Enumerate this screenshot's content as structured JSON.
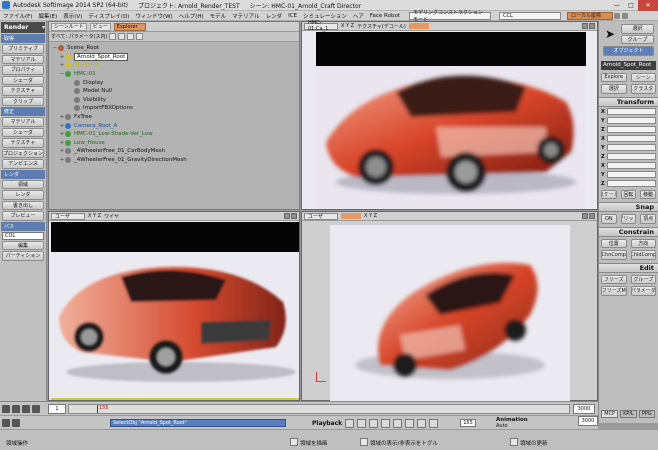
{
  "titlebar": {
    "app": "Autodesk Softimage 2014 SP2 (64-bit)",
    "project": "プロジェクト: Arnold_Render_TEST",
    "scene": "シーン: HMC-01_Arnold_Craft Director"
  },
  "menubar": {
    "items": [
      "ファイル(F)",
      "編集(E)",
      "表示(V)",
      "ディスプレイ(D)",
      "ウィンドウ(W)",
      "ヘルプ(H)",
      "モデル",
      "マテリアル",
      "レンダ",
      "ICE",
      "シミュレーション",
      "ヘア",
      "Face Robot"
    ],
    "layout": "モデリングコンストラクションモード",
    "combo": "CCL",
    "layer": "ローカル座標"
  },
  "leftbar": {
    "mode": "Render",
    "sections": [
      {
        "title": "取得",
        "items": [
          "プリミティブ",
          "マテリアル",
          "プロパティ",
          "シェーダ",
          "テクスチャ",
          "クリップ"
        ]
      },
      {
        "title": "修正",
        "items": [
          "マテリアル",
          "シェーダ",
          "テクスチャ",
          "プロジェクション",
          "アンビエンス"
        ]
      },
      {
        "title": "レンダ",
        "items": [
          "領域",
          "レンダ",
          "書き出し",
          "プレビュー"
        ]
      },
      {
        "title": "パス",
        "items": []
      }
    ],
    "pass_field": "COL",
    "bottom_items": [
      "編集",
      "パーティション"
    ]
  },
  "explorer": {
    "scope": "シーンルート",
    "view": "ビュー",
    "filter": "すべて: パラメータ(ス内)",
    "display": "Explorer",
    "nodes": [
      {
        "label": "Scene_Root",
        "level": 0,
        "color": "#b06030",
        "selected": false
      },
      {
        "label": "Arnold_Spot_Root",
        "level": 1,
        "color": "#d0c030",
        "selected": true
      },
      {
        "label": "Skydome",
        "level": 1,
        "color": "#d0c030",
        "selected": false
      },
      {
        "label": "HMC-01",
        "level": 1,
        "color": "#40a040",
        "selected": false
      },
      {
        "label": "Display",
        "level": 2,
        "color": "#7a7a7a",
        "selected": false
      },
      {
        "label": "Model Null",
        "level": 2,
        "color": "#7a7a7a",
        "selected": false
      },
      {
        "label": "Visibility",
        "level": 2,
        "color": "#7a7a7a",
        "selected": false
      },
      {
        "label": "ImportFBXOptions",
        "level": 2,
        "color": "#7a7a7a",
        "selected": false
      },
      {
        "label": "FxTree",
        "level": 1,
        "color": "#7a7a7a",
        "selected": false
      },
      {
        "label": "Camera_Root_A",
        "level": 1,
        "color": "#3a70c0",
        "selected": false
      },
      {
        "label": "HMC-01_Low-Shade-Ver_Low",
        "level": 1,
        "color": "#40a040",
        "selected": false
      },
      {
        "label": "Low_House",
        "level": 1,
        "color": "#40a040",
        "selected": false
      },
      {
        "label": "_4WheelerFree_01_CarBodyMesh",
        "level": 1,
        "color": "#7a7a7a",
        "selected": false
      },
      {
        "label": "_4WheelerFree_01_GravityDirectionMesh",
        "level": 1,
        "color": "#7a7a7a",
        "selected": false
      }
    ]
  },
  "viewports": [
    {
      "camera": "HMC-01:Ca_1",
      "shading": "テクスチャ(デコール)",
      "axes": "X Y Z"
    },
    {
      "camera": "ユーザ",
      "shading": "ワイヤ",
      "axes": "X Y Z"
    },
    {
      "camera": "ユーザ",
      "shading": "",
      "axes": "X Y Z"
    }
  ],
  "rightbar": {
    "buttons_top": [
      "選択",
      "グループ",
      "オブジェクト"
    ],
    "object_name": "Arnold_Spot_Root",
    "explore_row": [
      "Explore",
      "シーン",
      "選択",
      "クラスタ"
    ],
    "transform_title": "Transform",
    "axes": [
      "X",
      "Y",
      "Z"
    ],
    "transform_rows": [
      "スケール",
      "回転",
      "移動"
    ],
    "snap_title": "Snap",
    "snap_buttons": [
      "ON",
      "グリッド",
      "頂点"
    ],
    "constrain_title": "Constrain",
    "constrain_buttons": [
      "位置",
      "方向",
      "ChnComp",
      "ChldComp"
    ],
    "edit_title": "Edit",
    "edit_buttons": [
      "フリーズ",
      "グループ",
      "フリーズM",
      "パラメータ"
    ],
    "footer_tabs": [
      "MCP",
      "KP/L",
      "PPG"
    ]
  },
  "timeline": {
    "start": "1",
    "current_marker": "155",
    "end": "3000",
    "end2": "3000"
  },
  "cmdbar": {
    "command": "SelectObj \"Arnold_Spot_Root\"",
    "playback": "Playback",
    "fps": "155",
    "animation": "Animation",
    "auto": "Auto"
  },
  "statusbar": {
    "left": "領域操作",
    "middle1": "領域を描画",
    "middle2": "領域の表示/非表示をトグル",
    "right": "領域の更新"
  }
}
